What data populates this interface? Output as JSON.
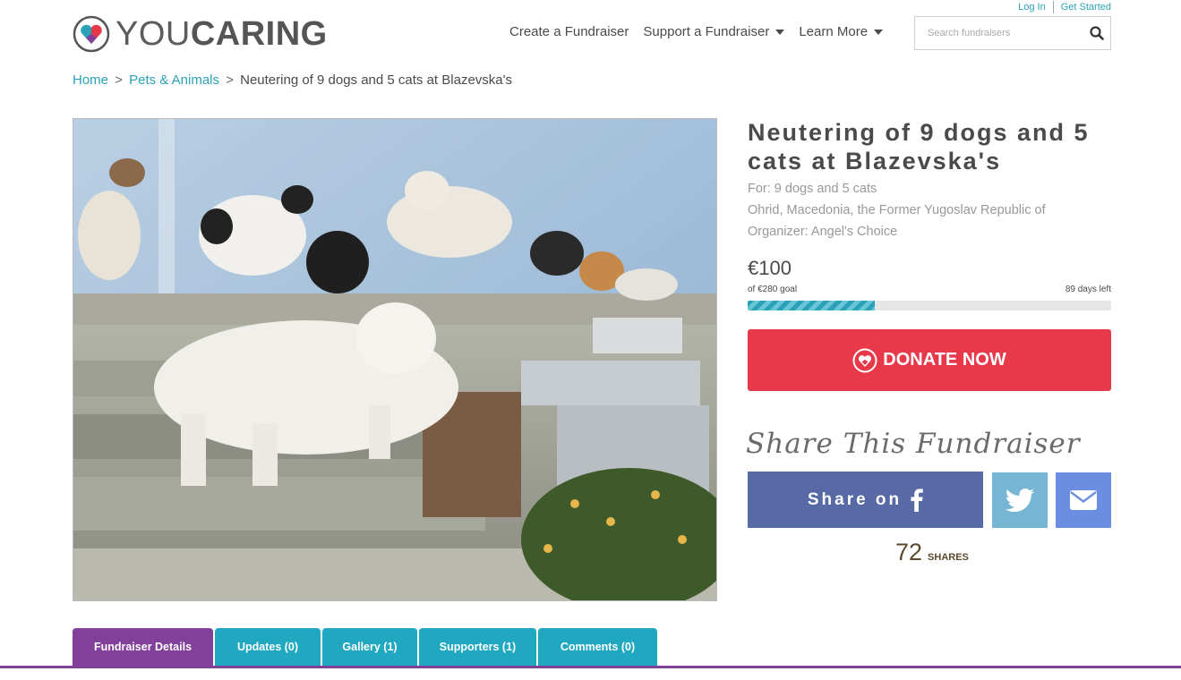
{
  "header": {
    "login_label": "Log In",
    "get_started_label": "Get Started",
    "logo_light": "YOU",
    "logo_bold": "CARING",
    "nav": [
      {
        "label": "Create a Fundraiser",
        "has_dropdown": false
      },
      {
        "label": "Support a Fundraiser",
        "has_dropdown": true
      },
      {
        "label": "Learn More",
        "has_dropdown": true
      }
    ],
    "search_placeholder": "Search fundraisers",
    "search_icon": "search-icon"
  },
  "breadcrumb": {
    "home": "Home",
    "category": "Pets & Animals",
    "current": "Neutering of 9 dogs and 5 cats at Blazevska's",
    "separator": ">"
  },
  "fundraiser": {
    "title": "Neutering of 9 dogs and 5 cats at Blazevska's",
    "for_line": "For: 9 dogs and 5 cats",
    "location": "Ohrid, Macedonia, the Former Yugoslav Republic of",
    "organizer_line": "Organizer: Angel's Choice",
    "amount_raised": "€100",
    "goal_text": "of €280 goal",
    "days_left": "89 days left",
    "progress_fraction": 0.35,
    "donate_label": "DONATE NOW"
  },
  "share": {
    "heading": "Share This Fundraiser",
    "facebook_label": "Share on",
    "count": "72",
    "count_label": "SHARES"
  },
  "tabs": [
    {
      "label": "Fundraiser Details",
      "active": true
    },
    {
      "label": "Updates (0)",
      "active": false
    },
    {
      "label": "Gallery (1)",
      "active": false
    },
    {
      "label": "Supporters (1)",
      "active": false
    },
    {
      "label": "Comments (0)",
      "active": false
    }
  ],
  "colors": {
    "brand_teal": "#2aa1b8",
    "donate_red": "#e8394a",
    "facebook": "#576aa6",
    "twitter": "#76b6d4",
    "email": "#6b8ee0",
    "tab_active": "#82409a",
    "tab_inactive": "#20a8c0"
  }
}
